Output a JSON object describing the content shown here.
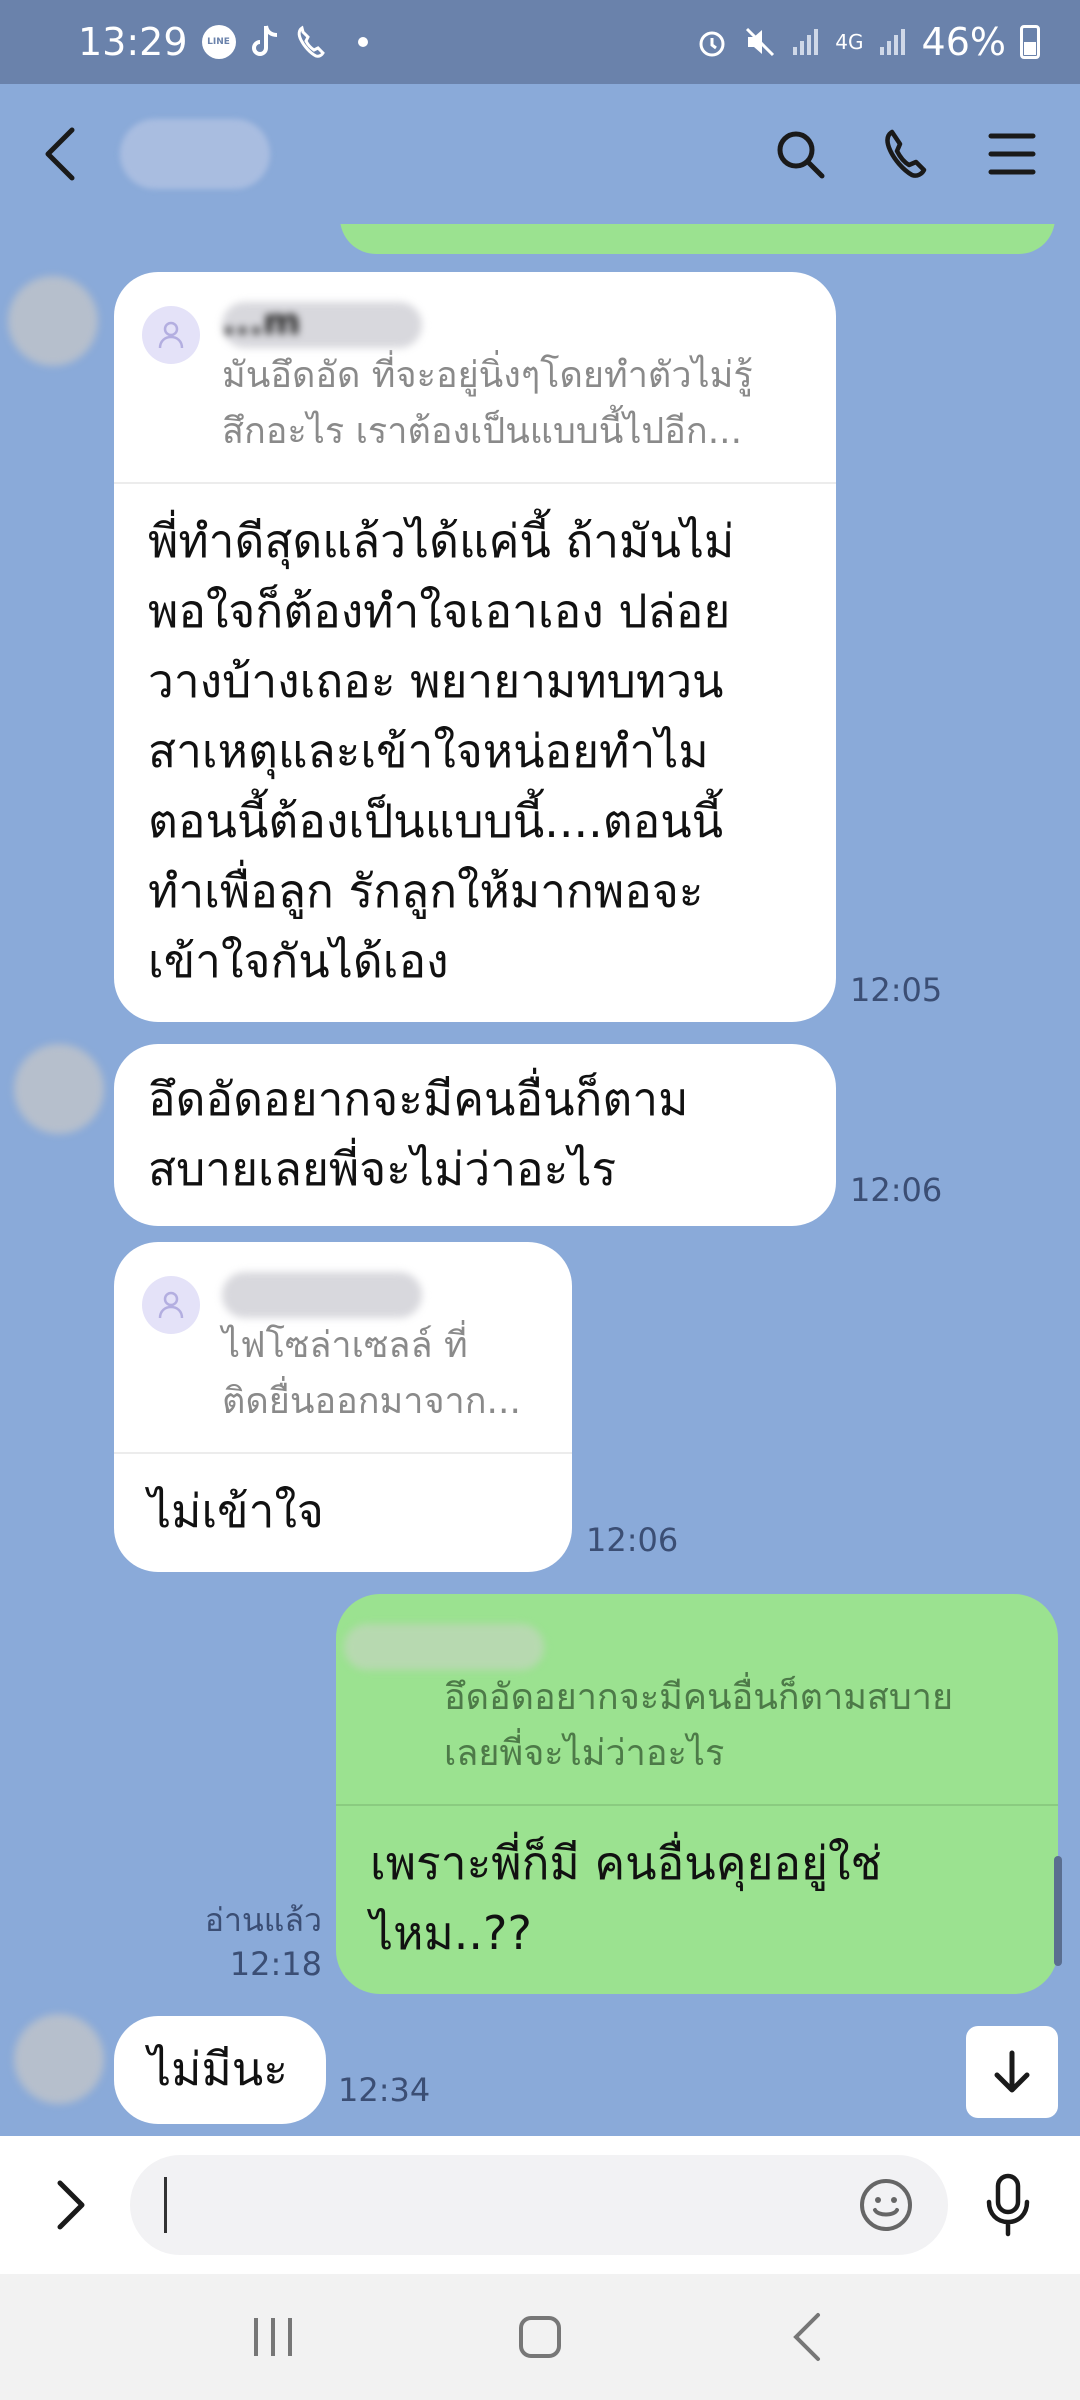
{
  "status_bar": {
    "time": "13:29",
    "line_badge": "LINE",
    "network": "4G",
    "battery": "46%"
  },
  "chat": {
    "messages": [
      {
        "quote_name": "...m",
        "quote_text_1": "มันอึดอัด ที่จะอยู่นิ่งๆโดยทำตัวไม่รู้",
        "quote_text_2": "สึกอะไร เราต้องเป็นแบบนี้ไปอีก...",
        "text_lines": [
          "พี่ทำดีสุดแล้วได้แค่นี้ ถ้ามันไม่",
          "พอใจก็ต้องทำใจเอาเอง ปล่อย",
          "วางบ้างเถอะ พยายามทบทวน",
          "สาเหตุและเข้าใจหน่อยทำไม",
          "ตอนนี้ต้องเป็นแบบนี้....ตอนนี้",
          "ทำเพื่อลูก รักลูกให้มากพอจะ",
          "เข้าใจกันได้เอง"
        ],
        "time": "12:05"
      },
      {
        "text_lines": [
          "อึดอัดอยากจะมีคนอื่นก็ตาม",
          "สบายเลยพี่จะไม่ว่าอะไร"
        ],
        "time": "12:06"
      },
      {
        "quote_text_1": "ไฟโซล่าเซลล์ ที่",
        "quote_text_2": "ติดยื่นออกมาจาก...",
        "text": "ไม่เข้าใจ",
        "time": "12:06"
      },
      {
        "quote_text_1": "อึดอัดอยากจะมีคนอื่นก็ตามสบาย",
        "quote_text_2": "เลยพี่จะไม่ว่าอะไร",
        "text_lines": [
          "เพราะพี่ก็มี คนอื่นคุยอยู่ใช่",
          "ไหม..??"
        ],
        "read_label": "อ่านแล้ว",
        "time": "12:18"
      },
      {
        "text": "ไม่มีนะ",
        "time": "12:34"
      }
    ]
  },
  "icons": {
    "back": "chevron-left-icon",
    "search": "search-icon",
    "call": "phone-icon",
    "menu": "menu-icon",
    "scroll_down": "arrow-down-icon",
    "expand": "chevron-right-icon",
    "emoji": "smiley-icon",
    "mic": "microphone-icon"
  },
  "colors": {
    "chat_background": "#8aaad9",
    "outgoing_bubble": "#9be290",
    "incoming_bubble": "#ffffff",
    "status_bar": "#6a82ab"
  }
}
